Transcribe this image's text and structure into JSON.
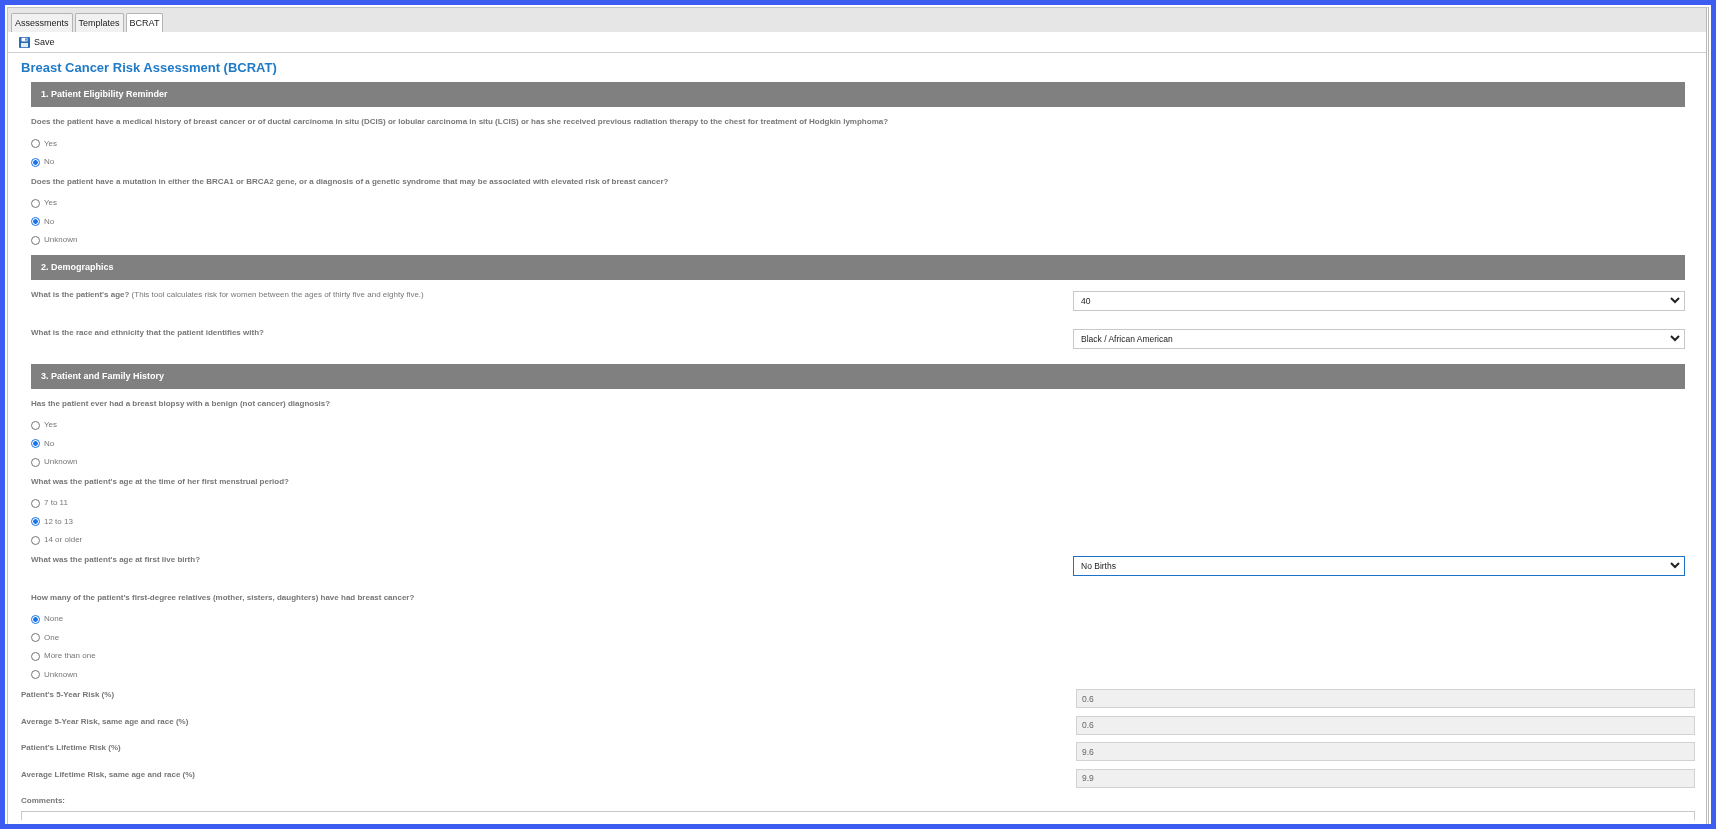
{
  "tabs": [
    {
      "label": "Assessments",
      "selected": false
    },
    {
      "label": "Templates",
      "selected": false
    },
    {
      "label": "BCRAT",
      "selected": true
    }
  ],
  "toolbar": {
    "save_button": "Save"
  },
  "title": "Breast Cancer Risk Assessment (BCRAT)",
  "sections": [
    {
      "heading": "1. Patient Eligibility Reminder",
      "questions": [
        {
          "kind": "radio",
          "text": "Does the patient have a medical history of breast cancer or of ductal carcinoma in situ (DCIS) or lobular carcinoma in situ (LCIS) or has she received previous radiation therapy to the chest for treatment of Hodgkin lymphoma?",
          "options": [
            {
              "label": "Yes",
              "selected": false
            },
            {
              "label": "No",
              "selected": true
            }
          ]
        },
        {
          "kind": "radio",
          "text": "Does the patient have a mutation in either the BRCA1 or BRCA2 gene, or a diagnosis of a genetic syndrome that may be associated with elevated risk of breast cancer?",
          "options": [
            {
              "label": "Yes",
              "selected": false
            },
            {
              "label": "No",
              "selected": true
            },
            {
              "label": "Unknown",
              "selected": false
            }
          ]
        }
      ]
    },
    {
      "heading": "2. Demographics",
      "questions": [
        {
          "kind": "select",
          "text": "What is the patient's age?",
          "note": "(This tool calculates risk for women between the ages of thirty five and eighty five.)",
          "value": "40",
          "focused": false
        },
        {
          "kind": "select",
          "text": "What is the race and ethnicity that the patient identifies with?",
          "value": "Black / African American",
          "focused": false
        }
      ]
    },
    {
      "heading": "3. Patient and Family History",
      "questions": [
        {
          "kind": "radio",
          "text": "Has the patient ever had a breast biopsy with a benign (not cancer) diagnosis?",
          "options": [
            {
              "label": "Yes",
              "selected": false
            },
            {
              "label": "No",
              "selected": true
            },
            {
              "label": "Unknown",
              "selected": false
            }
          ]
        },
        {
          "kind": "radio",
          "text": "What was the patient's age at the time of her first menstrual period?",
          "options": [
            {
              "label": "7 to 11",
              "selected": false
            },
            {
              "label": "12 to 13",
              "selected": true
            },
            {
              "label": "14 or older",
              "selected": false
            }
          ]
        },
        {
          "kind": "select",
          "text": "What was the patient's age at first live birth?",
          "value": "No Births",
          "focused": true
        },
        {
          "kind": "radio",
          "text": "How many of the patient's first-degree relatives (mother, sisters, daughters) have had breast cancer?",
          "options": [
            {
              "label": "None",
              "selected": true
            },
            {
              "label": "One",
              "selected": false
            },
            {
              "label": "More than one",
              "selected": false
            },
            {
              "label": "Unknown",
              "selected": false
            }
          ]
        }
      ]
    }
  ],
  "results": [
    {
      "label": "Patient's 5-Year Risk (%)",
      "value": "0.6"
    },
    {
      "label": "Average 5-Year Risk, same age and race (%)",
      "value": "0.6"
    },
    {
      "label": "Patient's Lifetime Risk (%)",
      "value": "9.6"
    },
    {
      "label": "Average Lifetime Risk, same age and race (%)",
      "value": "9.9"
    }
  ],
  "comments": {
    "label": "Comments:"
  }
}
